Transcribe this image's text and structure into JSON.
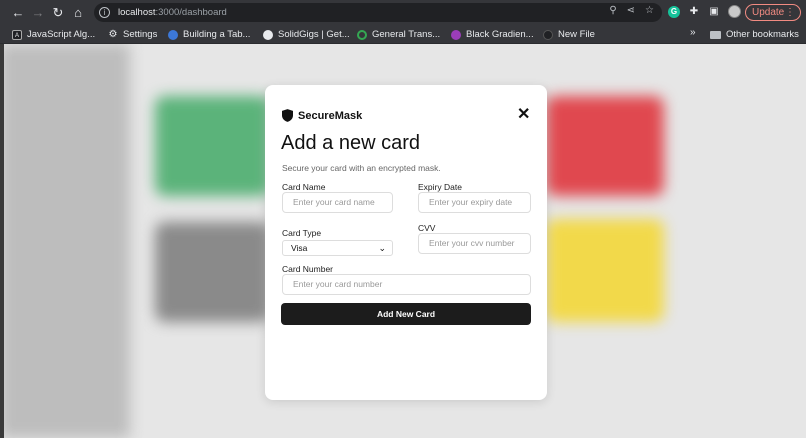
{
  "browser": {
    "url_host": "localhost",
    "url_path": ":3000/dashboard",
    "update_label": "Update",
    "update_dots": "⋮"
  },
  "bookmarks": {
    "items": [
      {
        "label": "JavaScript Alg...",
        "icon": "js-algorithms-icon"
      },
      {
        "label": "Settings",
        "icon": "gear-icon"
      },
      {
        "label": "Building a Tab...",
        "icon": "site-icon"
      },
      {
        "label": "SolidGigs | Get...",
        "icon": "solidgigs-icon"
      },
      {
        "label": "General Trans...",
        "icon": "headset-icon"
      },
      {
        "label": "Black Gradien...",
        "icon": "gradient-icon"
      },
      {
        "label": "New File",
        "icon": "github-icon"
      }
    ],
    "more": "»",
    "other_label": "Other bookmarks"
  },
  "modal": {
    "brand": "SecureMask",
    "close": "✕",
    "title": "Add a new card",
    "subtitle": "Secure your card with an encrypted mask.",
    "card_name": {
      "label": "Card Name",
      "placeholder": "Enter your card name"
    },
    "expiry": {
      "label": "Expiry Date",
      "placeholder": "Enter your expiry date"
    },
    "card_type": {
      "label": "Card Type",
      "value": "Visa"
    },
    "cvv": {
      "label": "CVV",
      "placeholder": "Enter your cvv number"
    },
    "card_number": {
      "label": "Card Number",
      "placeholder": "Enter your card number"
    },
    "submit_label": "Add New Card"
  },
  "colors": {
    "accent": "#1c1c1c",
    "card_green": "#5bb37a",
    "card_red": "#e0484f",
    "card_grey": "#8a8a8a",
    "card_yellow": "#f2d94a"
  }
}
